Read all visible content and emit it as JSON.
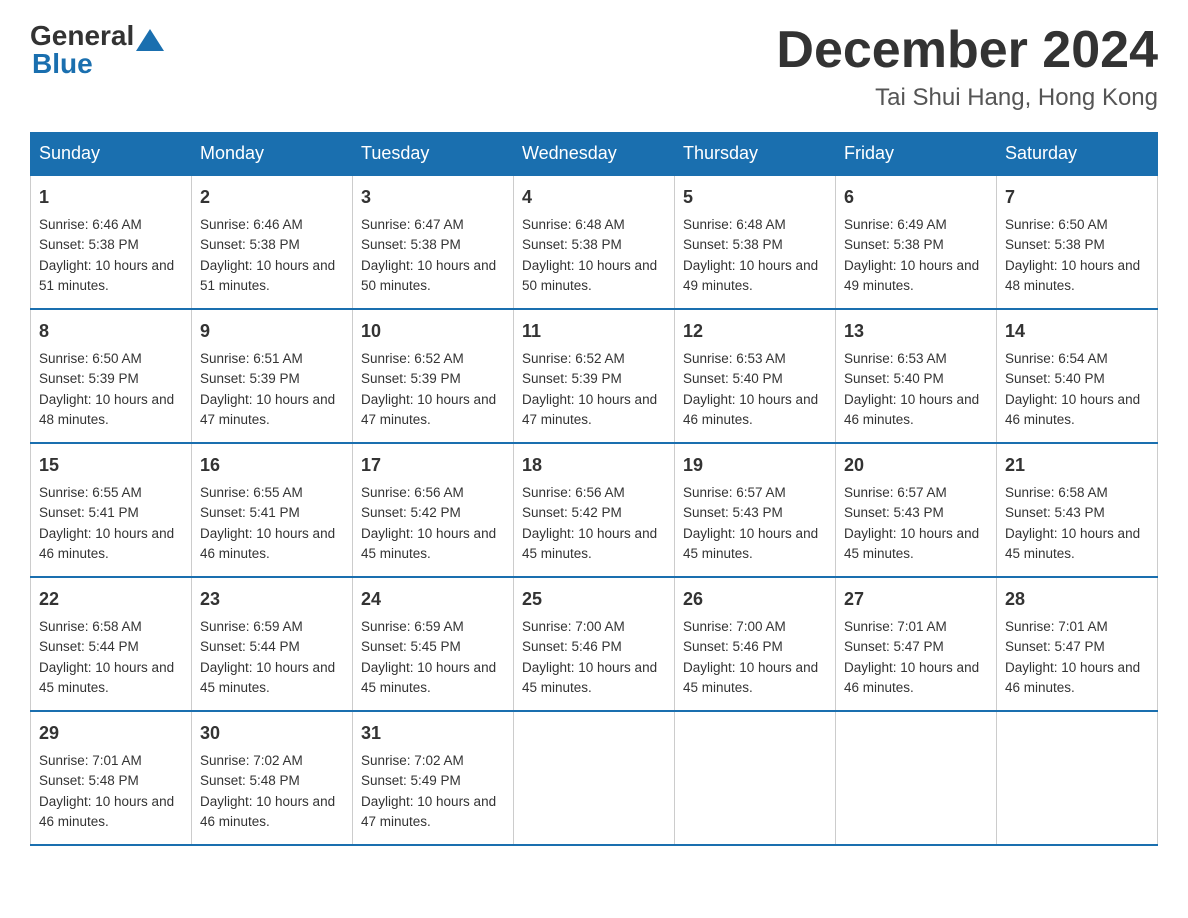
{
  "header": {
    "logo_general": "General",
    "logo_blue": "Blue",
    "main_title": "December 2024",
    "subtitle": "Tai Shui Hang, Hong Kong"
  },
  "days_of_week": [
    "Sunday",
    "Monday",
    "Tuesday",
    "Wednesday",
    "Thursday",
    "Friday",
    "Saturday"
  ],
  "weeks": [
    [
      {
        "day": "1",
        "sunrise": "6:46 AM",
        "sunset": "5:38 PM",
        "daylight": "10 hours and 51 minutes."
      },
      {
        "day": "2",
        "sunrise": "6:46 AM",
        "sunset": "5:38 PM",
        "daylight": "10 hours and 51 minutes."
      },
      {
        "day": "3",
        "sunrise": "6:47 AM",
        "sunset": "5:38 PM",
        "daylight": "10 hours and 50 minutes."
      },
      {
        "day": "4",
        "sunrise": "6:48 AM",
        "sunset": "5:38 PM",
        "daylight": "10 hours and 50 minutes."
      },
      {
        "day": "5",
        "sunrise": "6:48 AM",
        "sunset": "5:38 PM",
        "daylight": "10 hours and 49 minutes."
      },
      {
        "day": "6",
        "sunrise": "6:49 AM",
        "sunset": "5:38 PM",
        "daylight": "10 hours and 49 minutes."
      },
      {
        "day": "7",
        "sunrise": "6:50 AM",
        "sunset": "5:38 PM",
        "daylight": "10 hours and 48 minutes."
      }
    ],
    [
      {
        "day": "8",
        "sunrise": "6:50 AM",
        "sunset": "5:39 PM",
        "daylight": "10 hours and 48 minutes."
      },
      {
        "day": "9",
        "sunrise": "6:51 AM",
        "sunset": "5:39 PM",
        "daylight": "10 hours and 47 minutes."
      },
      {
        "day": "10",
        "sunrise": "6:52 AM",
        "sunset": "5:39 PM",
        "daylight": "10 hours and 47 minutes."
      },
      {
        "day": "11",
        "sunrise": "6:52 AM",
        "sunset": "5:39 PM",
        "daylight": "10 hours and 47 minutes."
      },
      {
        "day": "12",
        "sunrise": "6:53 AM",
        "sunset": "5:40 PM",
        "daylight": "10 hours and 46 minutes."
      },
      {
        "day": "13",
        "sunrise": "6:53 AM",
        "sunset": "5:40 PM",
        "daylight": "10 hours and 46 minutes."
      },
      {
        "day": "14",
        "sunrise": "6:54 AM",
        "sunset": "5:40 PM",
        "daylight": "10 hours and 46 minutes."
      }
    ],
    [
      {
        "day": "15",
        "sunrise": "6:55 AM",
        "sunset": "5:41 PM",
        "daylight": "10 hours and 46 minutes."
      },
      {
        "day": "16",
        "sunrise": "6:55 AM",
        "sunset": "5:41 PM",
        "daylight": "10 hours and 46 minutes."
      },
      {
        "day": "17",
        "sunrise": "6:56 AM",
        "sunset": "5:42 PM",
        "daylight": "10 hours and 45 minutes."
      },
      {
        "day": "18",
        "sunrise": "6:56 AM",
        "sunset": "5:42 PM",
        "daylight": "10 hours and 45 minutes."
      },
      {
        "day": "19",
        "sunrise": "6:57 AM",
        "sunset": "5:43 PM",
        "daylight": "10 hours and 45 minutes."
      },
      {
        "day": "20",
        "sunrise": "6:57 AM",
        "sunset": "5:43 PM",
        "daylight": "10 hours and 45 minutes."
      },
      {
        "day": "21",
        "sunrise": "6:58 AM",
        "sunset": "5:43 PM",
        "daylight": "10 hours and 45 minutes."
      }
    ],
    [
      {
        "day": "22",
        "sunrise": "6:58 AM",
        "sunset": "5:44 PM",
        "daylight": "10 hours and 45 minutes."
      },
      {
        "day": "23",
        "sunrise": "6:59 AM",
        "sunset": "5:44 PM",
        "daylight": "10 hours and 45 minutes."
      },
      {
        "day": "24",
        "sunrise": "6:59 AM",
        "sunset": "5:45 PM",
        "daylight": "10 hours and 45 minutes."
      },
      {
        "day": "25",
        "sunrise": "7:00 AM",
        "sunset": "5:46 PM",
        "daylight": "10 hours and 45 minutes."
      },
      {
        "day": "26",
        "sunrise": "7:00 AM",
        "sunset": "5:46 PM",
        "daylight": "10 hours and 45 minutes."
      },
      {
        "day": "27",
        "sunrise": "7:01 AM",
        "sunset": "5:47 PM",
        "daylight": "10 hours and 46 minutes."
      },
      {
        "day": "28",
        "sunrise": "7:01 AM",
        "sunset": "5:47 PM",
        "daylight": "10 hours and 46 minutes."
      }
    ],
    [
      {
        "day": "29",
        "sunrise": "7:01 AM",
        "sunset": "5:48 PM",
        "daylight": "10 hours and 46 minutes."
      },
      {
        "day": "30",
        "sunrise": "7:02 AM",
        "sunset": "5:48 PM",
        "daylight": "10 hours and 46 minutes."
      },
      {
        "day": "31",
        "sunrise": "7:02 AM",
        "sunset": "5:49 PM",
        "daylight": "10 hours and 47 minutes."
      },
      null,
      null,
      null,
      null
    ]
  ],
  "labels": {
    "sunrise": "Sunrise:",
    "sunset": "Sunset:",
    "daylight": "Daylight:"
  }
}
